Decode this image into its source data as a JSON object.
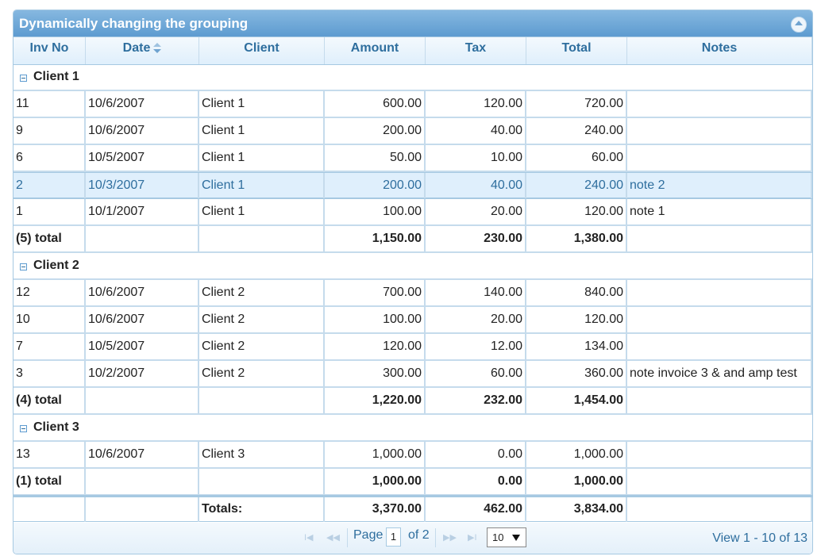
{
  "caption": "Dynamically changing the grouping",
  "columns": [
    "Inv No",
    "Date",
    "Client",
    "Amount",
    "Tax",
    "Total",
    "Notes"
  ],
  "groups": [
    {
      "label": "Client 1",
      "rows": [
        [
          "11",
          "10/6/2007",
          "Client 1",
          "600.00",
          "120.00",
          "720.00",
          ""
        ],
        [
          "9",
          "10/6/2007",
          "Client 1",
          "200.00",
          "40.00",
          "240.00",
          ""
        ],
        [
          "6",
          "10/5/2007",
          "Client 1",
          "50.00",
          "10.00",
          "60.00",
          ""
        ],
        [
          "2",
          "10/3/2007",
          "Client 1",
          "200.00",
          "40.00",
          "240.00",
          "note 2"
        ],
        [
          "1",
          "10/1/2007",
          "Client 1",
          "100.00",
          "20.00",
          "120.00",
          "note 1"
        ]
      ],
      "summary": [
        "(5) total",
        "",
        "",
        "1,150.00",
        "230.00",
        "1,380.00",
        ""
      ]
    },
    {
      "label": "Client 2",
      "rows": [
        [
          "12",
          "10/6/2007",
          "Client 2",
          "700.00",
          "140.00",
          "840.00",
          ""
        ],
        [
          "10",
          "10/6/2007",
          "Client 2",
          "100.00",
          "20.00",
          "120.00",
          ""
        ],
        [
          "7",
          "10/5/2007",
          "Client 2",
          "120.00",
          "12.00",
          "134.00",
          ""
        ],
        [
          "3",
          "10/2/2007",
          "Client 2",
          "300.00",
          "60.00",
          "360.00",
          "note invoice 3 & and amp test"
        ]
      ],
      "summary": [
        "(4) total",
        "",
        "",
        "1,220.00",
        "232.00",
        "1,454.00",
        ""
      ]
    },
    {
      "label": "Client 3",
      "rows": [
        [
          "13",
          "10/6/2007",
          "Client 3",
          "1,000.00",
          "0.00",
          "1,000.00",
          ""
        ]
      ],
      "summary": [
        "(1) total",
        "",
        "",
        "1,000.00",
        "0.00",
        "1,000.00",
        ""
      ]
    }
  ],
  "selected_inv_no": "2",
  "totals": [
    "",
    "",
    "Totals:",
    "3,370.00",
    "462.00",
    "3,834.00",
    ""
  ],
  "pager": {
    "page_label": "Page",
    "page_value": "1",
    "of_label": "of 2",
    "rows_per_page": "10",
    "view_text": "View 1 - 10 of 13"
  },
  "sorted_column": "Date"
}
